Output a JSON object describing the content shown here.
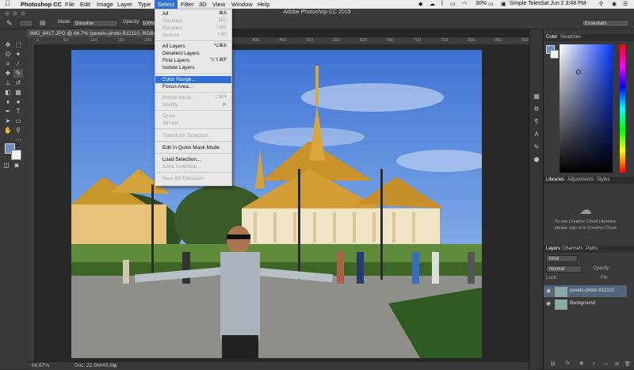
{
  "menubar": {
    "app": "Photoshop CC",
    "menus": [
      "File",
      "Edit",
      "Image",
      "Layer",
      "Type",
      "Select",
      "Filter",
      "3D",
      "View",
      "Window",
      "Help"
    ],
    "active_menu": "Select",
    "battery": "30%",
    "account": "Simple Telex",
    "clock": "Sat Jun 2  3:48 PM"
  },
  "window": {
    "title": "Adobe Photoshop CC 2015"
  },
  "options": {
    "mode_label": "Mode:",
    "mode_value": "Dissolve",
    "opacity_label": "Opacity:",
    "opacity_value": "100%",
    "workspace": "Essentials"
  },
  "document": {
    "tab_title": "IMG_8417.JPG @ 66.7% (pexels-photo-912110, RGB/8)",
    "zoom": "66.67%",
    "doc_size": "Doc: 22.9M/49.8M"
  },
  "ruler_ticks": [
    "0",
    "50",
    "100",
    "150",
    "200",
    "250",
    "300",
    "350",
    "400",
    "450",
    "500",
    "550",
    "600",
    "650",
    "700",
    "750",
    "800",
    "850",
    "900"
  ],
  "select_menu": {
    "items": [
      {
        "label": "All",
        "shortcut": "⌘A",
        "disabled": false
      },
      {
        "label": "Deselect",
        "shortcut": "⌘D",
        "disabled": true
      },
      {
        "label": "Reselect",
        "shortcut": "⇧⌘D",
        "disabled": true
      },
      {
        "label": "Inverse",
        "shortcut": "⇧⌘I",
        "disabled": true
      },
      {
        "sep": true
      },
      {
        "label": "All Layers",
        "shortcut": "⌥⌘A",
        "disabled": false
      },
      {
        "label": "Deselect Layers",
        "shortcut": "",
        "disabled": false
      },
      {
        "label": "Find Layers",
        "shortcut": "⌥⇧⌘F",
        "disabled": false
      },
      {
        "label": "Isolate Layers",
        "shortcut": "",
        "disabled": false
      },
      {
        "sep": true
      },
      {
        "label": "Color Range...",
        "shortcut": "",
        "disabled": false,
        "highlighted": true
      },
      {
        "label": "Focus Area...",
        "shortcut": "",
        "disabled": false
      },
      {
        "sep": true
      },
      {
        "label": "Refine Mask...",
        "shortcut": "⌥⌘R",
        "disabled": true
      },
      {
        "label": "Modify",
        "shortcut": "▶",
        "disabled": true
      },
      {
        "sep": true
      },
      {
        "label": "Grow",
        "shortcut": "",
        "disabled": true
      },
      {
        "label": "Similar",
        "shortcut": "",
        "disabled": true
      },
      {
        "sep": true
      },
      {
        "label": "Transform Selection",
        "shortcut": "",
        "disabled": true
      },
      {
        "sep": true
      },
      {
        "label": "Edit in Quick Mask Mode",
        "shortcut": "",
        "disabled": false
      },
      {
        "sep": true
      },
      {
        "label": "Load Selection...",
        "shortcut": "",
        "disabled": false
      },
      {
        "label": "Save Selection...",
        "shortcut": "",
        "disabled": true
      },
      {
        "sep": true
      },
      {
        "label": "New 3D Extrusion",
        "shortcut": "",
        "disabled": true
      }
    ]
  },
  "color_panel": {
    "tabs": [
      "Color",
      "Swatches"
    ]
  },
  "libraries_panel": {
    "tabs": [
      "Libraries",
      "Adjustments",
      "Styles"
    ],
    "message_line1": "To use Creative Cloud Libraries,",
    "message_line2": "please sign in to Creative Cloud."
  },
  "layers_panel": {
    "tabs": [
      "Layers",
      "Channels",
      "Paths"
    ],
    "filter": "Kind",
    "blend_mode": "Normal",
    "opacity_label": "Opacity:",
    "lock_label": "Lock:",
    "fill_label": "Fill:",
    "layers": [
      {
        "name": "pexels-photo-912110",
        "selected": true
      },
      {
        "name": "Background",
        "selected": false
      }
    ]
  },
  "colors": {
    "highlight": "#2f6fd8",
    "panel": "#3a3a3a"
  }
}
